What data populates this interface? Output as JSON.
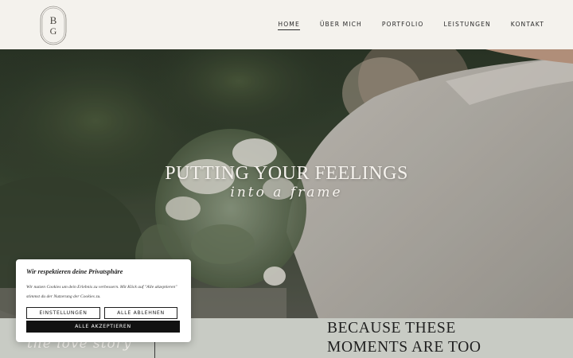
{
  "header": {
    "logo": {
      "monogram_top": "B",
      "monogram_bottom": "G",
      "icon": "monogram-logo"
    },
    "nav": [
      {
        "label": "HOME",
        "active": true
      },
      {
        "label": "ÜBER MICH",
        "active": false
      },
      {
        "label": "PORTFOLIO",
        "active": false
      },
      {
        "label": "LEISTUNGEN",
        "active": false
      },
      {
        "label": "KONTAKT",
        "active": false
      }
    ]
  },
  "hero": {
    "title": "PUTTING YOUR FEELINGS",
    "script": "into a frame"
  },
  "section": {
    "script": "the love story",
    "heading_line1": "BECAUSE THESE",
    "heading_line2": "MOMENTS ARE TOO"
  },
  "cookie_banner": {
    "title": "Wir respektieren deine Privatsphäre",
    "text": "Wir nutzen Cookies um dein Erlebnis zu verbessern. Mit Klick auf \"Alle akzeptieren\" stimmst du der Nutzerung der Cookies zu.",
    "settings_label": "EINSTELLUNGEN",
    "decline_label": "ALLE ABLEHNEN",
    "accept_label": "ALLE AKZEPTIEREN"
  },
  "colors": {
    "header_bg": "#f4f2ed",
    "section_bg": "#c8cbc4",
    "text_dark": "#1f1f1f",
    "accept_bg": "#121212"
  }
}
